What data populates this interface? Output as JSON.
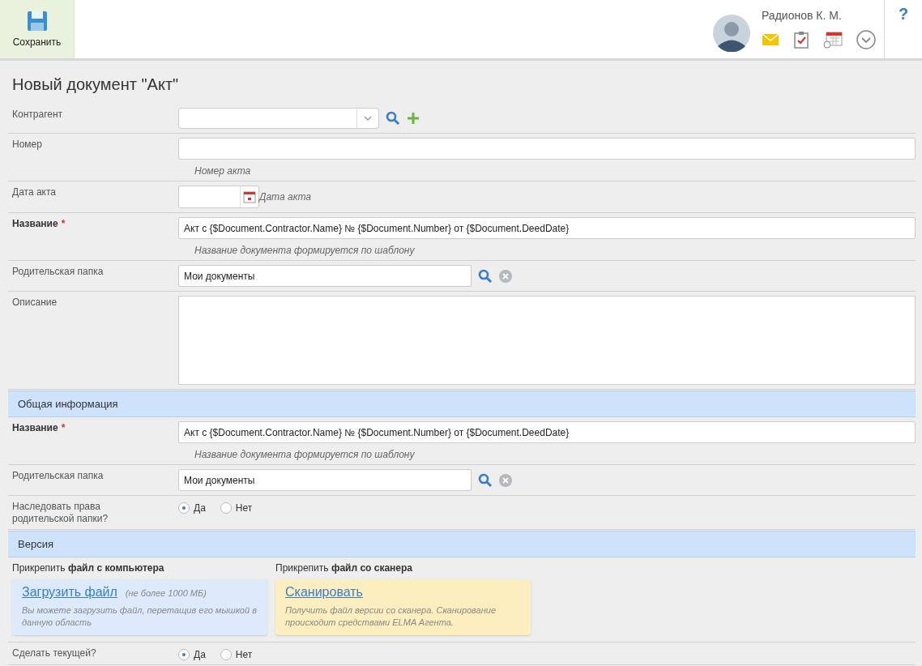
{
  "toolbar": {
    "save_label": "Сохранить",
    "user_name": "Радионов К. М.",
    "help": "?"
  },
  "title": "Новый документ \"Акт\"",
  "rows": [
    {
      "kind": "combo",
      "label": "Контрагент",
      "value": ""
    },
    {
      "kind": "text",
      "label": "Номер",
      "value": "",
      "hint": "Номер акта"
    },
    {
      "kind": "date",
      "label": "Дата акта",
      "value": "",
      "hint": "Дата акта"
    },
    {
      "kind": "text",
      "label": "Название",
      "required_mark": "*",
      "value": "Акт с {$Document.Contractor.Name} № {$Document.Number} от {$Document.DeedDate}",
      "hint": "Название документа формируется по шаблону"
    },
    {
      "kind": "folder",
      "label": "Родительская папка",
      "value": "Мои документы"
    },
    {
      "kind": "textarea",
      "label": "Описание",
      "value": ""
    },
    {
      "kind": "section",
      "label": "Общая информация"
    },
    {
      "kind": "text",
      "label": "Название",
      "required_mark": "*",
      "value": "Акт с {$Document.Contractor.Name} № {$Document.Number} от {$Document.DeedDate}",
      "hint": "Название документа формируется по шаблону"
    },
    {
      "kind": "folder",
      "label": "Родительская папка",
      "value": "Мои документы"
    },
    {
      "kind": "radio",
      "label": "Наследовать права родительской папки?",
      "options": [
        {
          "label": "Да",
          "selected": true
        },
        {
          "label": "Нет",
          "selected": false
        }
      ]
    },
    {
      "kind": "section",
      "label": "Версия"
    },
    {
      "kind": "attach",
      "cards": [
        {
          "kind": "upload",
          "heading": "Прикрепить **файл с компьютера**",
          "link": "Загрузить файл",
          "note": "(не более 1000 МБ)",
          "description": "Вы можете загрузить файл, перетащив его мышкой в данную область"
        },
        {
          "kind": "scan",
          "heading": "Прикрепить **файл со сканера**",
          "link": "Сканировать",
          "description": "Получить файл версии со сканера. Сканирование происходит средствами ELMA Агента."
        }
      ]
    },
    {
      "kind": "radio",
      "label": "Сделать текущей?",
      "options": [
        {
          "label": "Да",
          "selected": true
        },
        {
          "label": "Нет",
          "selected": false
        }
      ]
    }
  ]
}
